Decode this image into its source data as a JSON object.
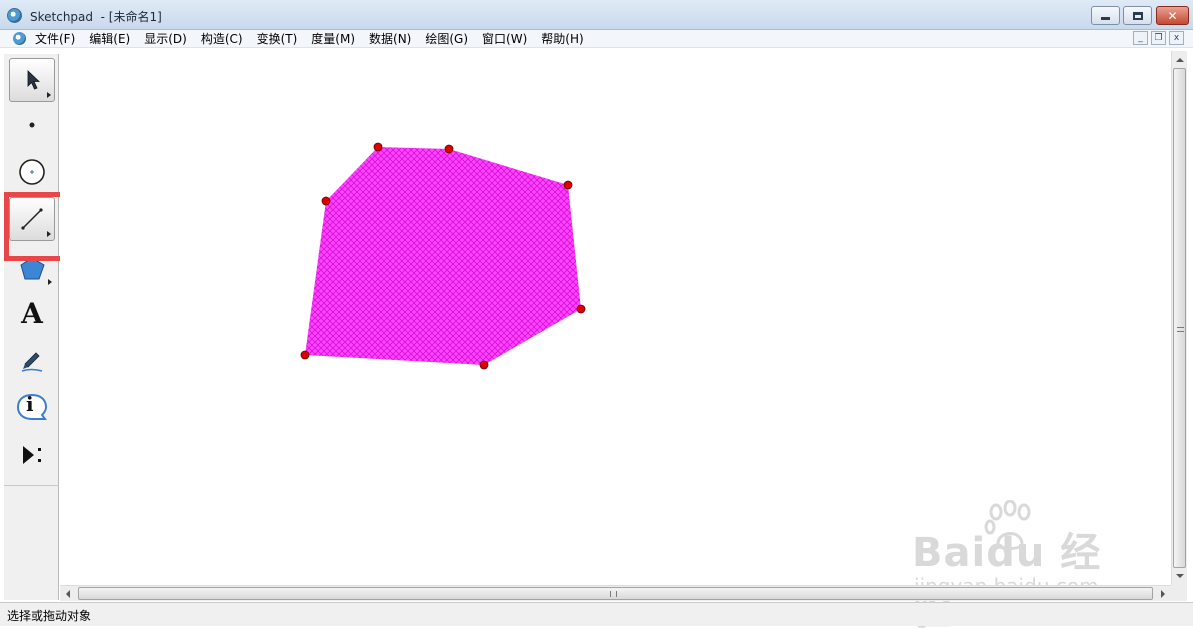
{
  "window": {
    "title": "Sketchpad  - [未命名1]",
    "close_glyph": "✕"
  },
  "menu": {
    "items": [
      {
        "label": "文件(F)"
      },
      {
        "label": "编辑(E)"
      },
      {
        "label": "显示(D)"
      },
      {
        "label": "构造(C)"
      },
      {
        "label": "变换(T)"
      },
      {
        "label": "度量(M)"
      },
      {
        "label": "数据(N)"
      },
      {
        "label": "绘图(G)"
      },
      {
        "label": "窗口(W)"
      },
      {
        "label": "帮助(H)"
      }
    ],
    "mdi_min": "_",
    "mdi_restore": "❐",
    "mdi_close": "x"
  },
  "toolbox": {
    "tools": [
      {
        "name": "arrow-select-tool",
        "icon": "arrow-pointer-icon"
      },
      {
        "name": "point-tool",
        "icon": "point-icon"
      },
      {
        "name": "compass-tool",
        "icon": "circle-compass-icon"
      },
      {
        "name": "straightedge-tool",
        "icon": "segment-icon",
        "selected": true
      },
      {
        "name": "polygon-tool",
        "icon": "polygon-icon"
      },
      {
        "name": "text-tool",
        "icon": "text-a-icon",
        "glyph": "A"
      },
      {
        "name": "marker-tool",
        "icon": "marker-pen-icon"
      },
      {
        "name": "information-tool",
        "icon": "info-bubble-icon",
        "glyph": "i"
      },
      {
        "name": "custom-tools",
        "icon": "play-custom-icon"
      }
    ]
  },
  "sketch": {
    "polygon_fill": "#ff33ff",
    "hatch_color": "#e020e0",
    "point_color": "#dd0000",
    "vertex_count": 7
  },
  "status": {
    "text": "选择或拖动对象"
  },
  "watermark": {
    "brand": "Baidu 经验",
    "site": "jingyan.baidu.com"
  },
  "colors": {
    "highlight": "#e9464a"
  }
}
